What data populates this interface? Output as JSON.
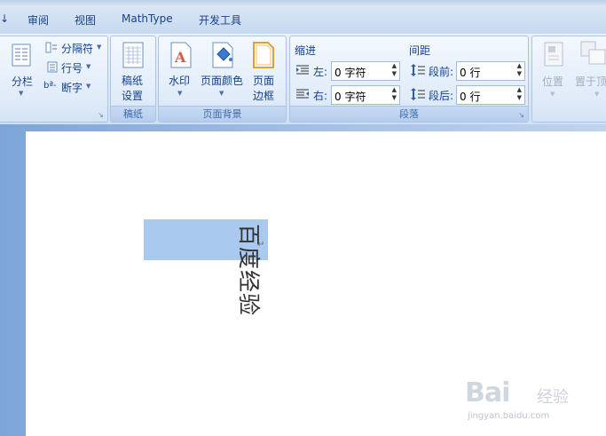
{
  "menu": {
    "tabs": [
      "审阅",
      "视图",
      "MathType",
      "开发工具"
    ]
  },
  "ribbon": {
    "columns": {
      "label": "分栏",
      "items": [
        "分隔符",
        "行号",
        "断字"
      ]
    },
    "manuscript": {
      "button": "稿纸\n设置",
      "line1": "稿纸",
      "line2": "设置",
      "group_label": "稿纸"
    },
    "page_background": {
      "watermark": "水印",
      "page_color": "页面颜色",
      "border_line1": "页面",
      "border_line2": "边框",
      "group_label": "页面背景"
    },
    "paragraph": {
      "indent_title": "缩进",
      "left_label": "左:",
      "left_value": "0 字符",
      "right_label": "右:",
      "right_value": "0 字符",
      "spacing_title": "间距",
      "before_label": "段前:",
      "before_value": "0 行",
      "after_label": "段后:",
      "after_value": "0 行",
      "group_label": "段落"
    },
    "arrange": {
      "position": "位置",
      "bring_front": "置于顶"
    }
  },
  "document": {
    "selected_text": "百度经验"
  },
  "watermark": {
    "logo": "Bai",
    "cn": "经验",
    "url": "jingyan.baidu.com"
  },
  "colors": {
    "selection": "#a9c9ef",
    "ribbon_text": "#15428b"
  }
}
